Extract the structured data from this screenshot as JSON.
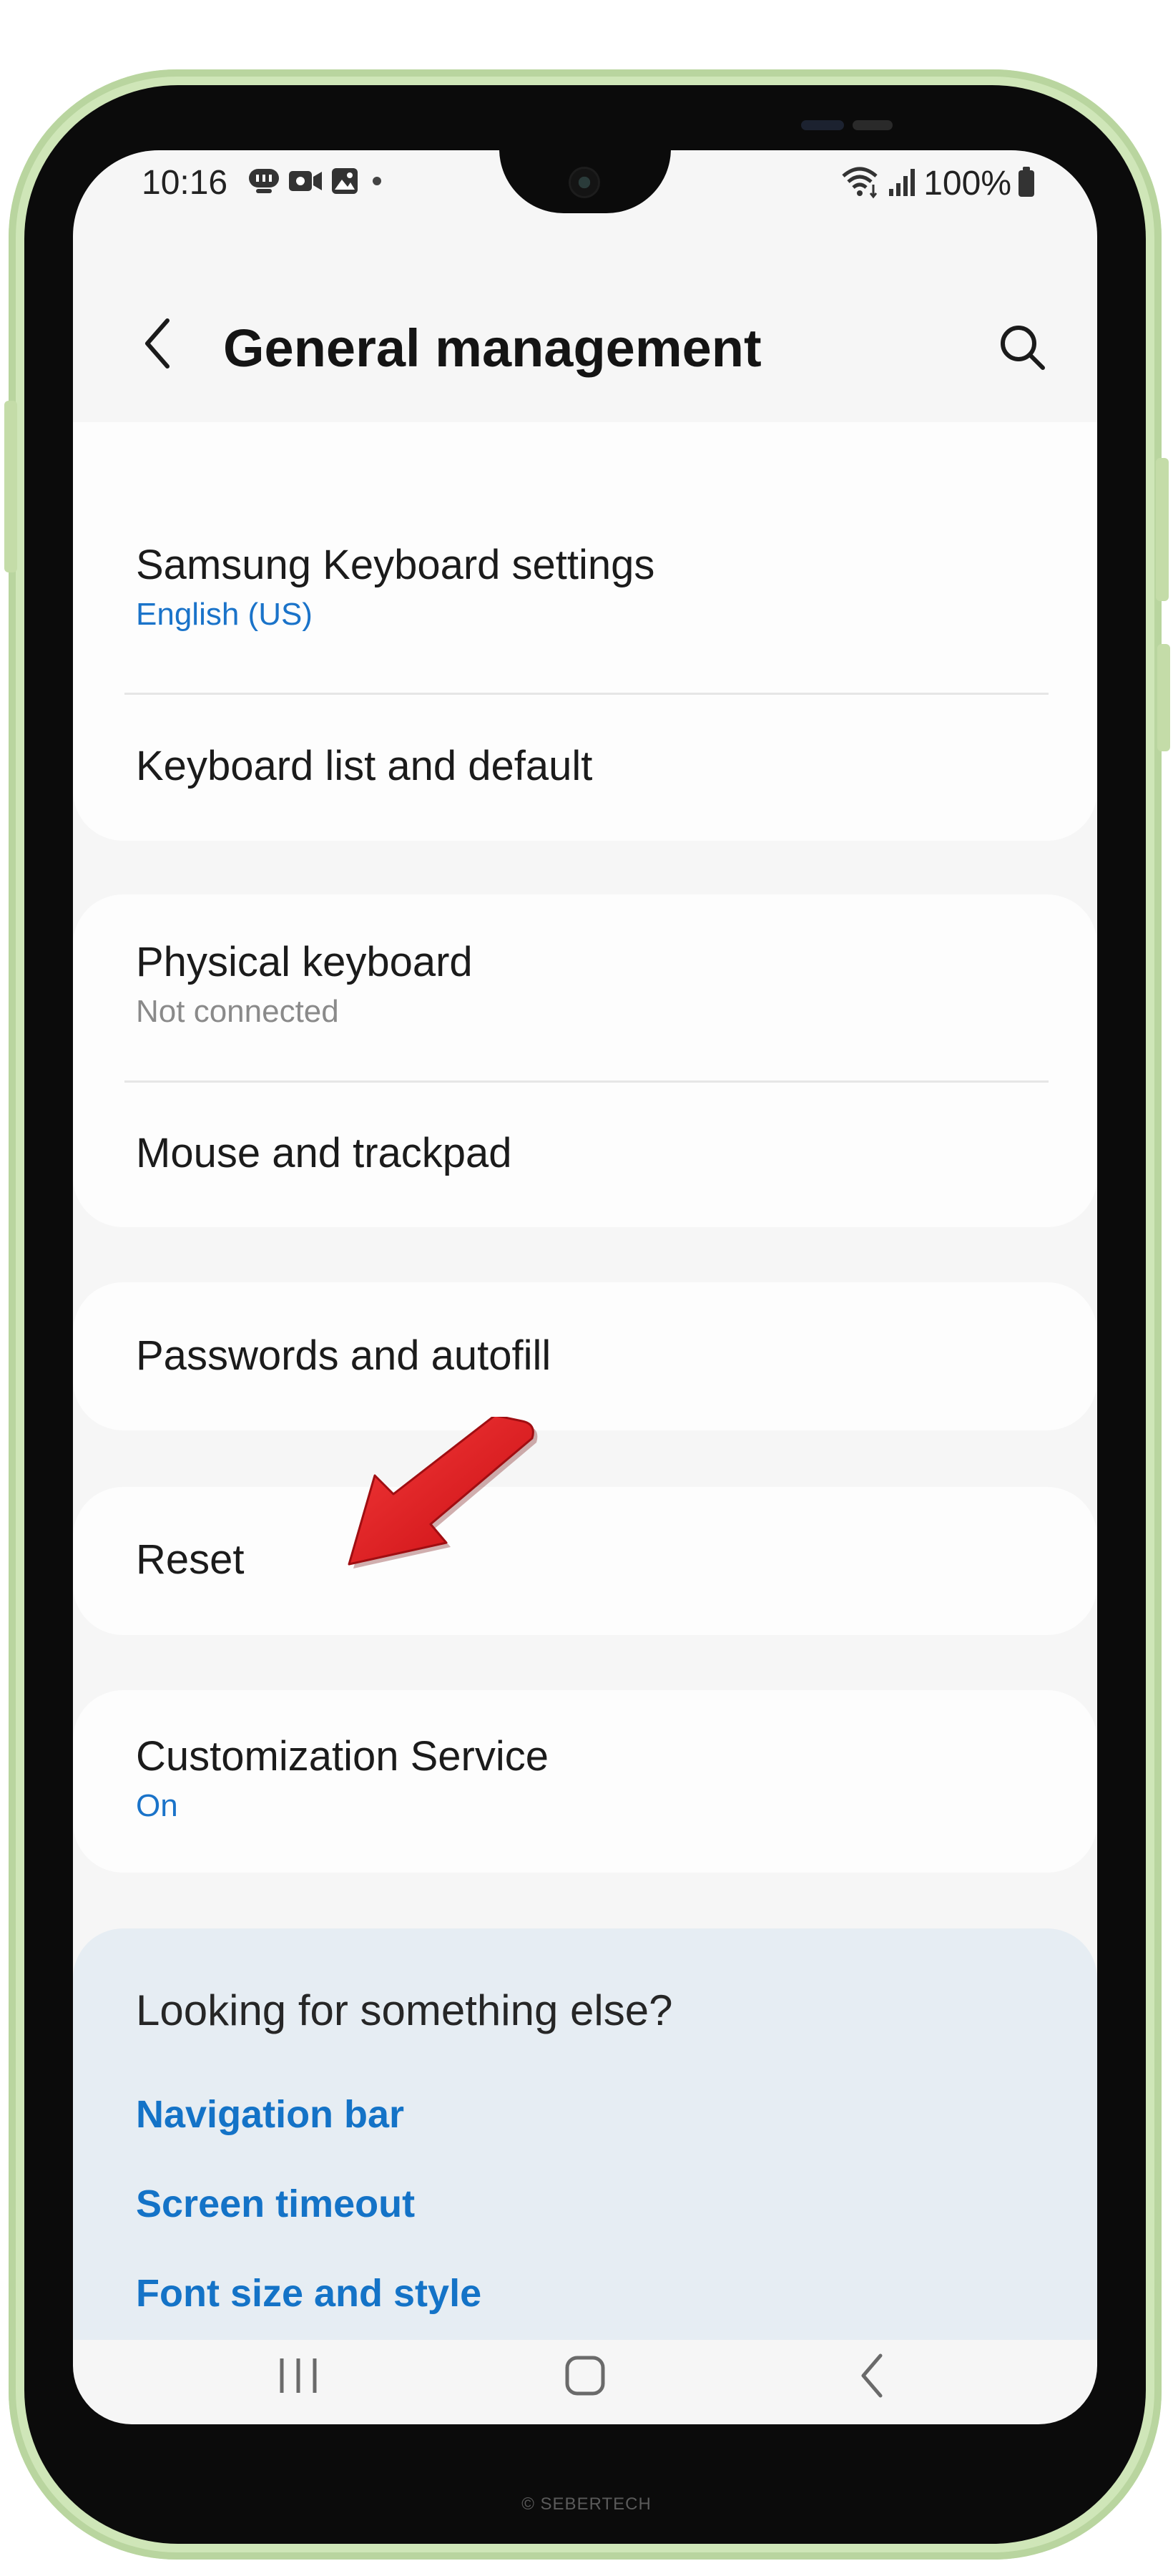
{
  "status_bar": {
    "time": "10:16",
    "battery": "100%",
    "left_icons": [
      "bixby-vision-icon",
      "video-call-icon",
      "gallery-icon",
      "dot-icon"
    ],
    "right_icons": [
      "wifi-icon",
      "signal-icon",
      "battery-icon"
    ]
  },
  "app_bar": {
    "title": "General management"
  },
  "settings": {
    "samsung_keyboard": {
      "title": "Samsung Keyboard settings",
      "sub": "English (US)"
    },
    "keyboard_list": {
      "title": "Keyboard list and default"
    },
    "physical_keyboard": {
      "title": "Physical keyboard",
      "sub": "Not connected"
    },
    "mouse_trackpad": {
      "title": "Mouse and trackpad"
    },
    "passwords": {
      "title": "Passwords and autofill"
    },
    "reset": {
      "title": "Reset"
    },
    "customization": {
      "title": "Customization Service",
      "sub": "On"
    }
  },
  "suggestions": {
    "heading": "Looking for something else?",
    "links": [
      "Navigation bar",
      "Screen timeout",
      "Font size and style"
    ]
  },
  "nav_bar": {
    "icons": [
      "recents-icon",
      "home-icon",
      "back-icon"
    ]
  },
  "watermark": "© SEBERTECH",
  "colors": {
    "accent_blue": "#1a73c9",
    "link_blue": "#1473c7",
    "arrow_red": "#e3161b",
    "frame_green": "#cfe6b8"
  }
}
